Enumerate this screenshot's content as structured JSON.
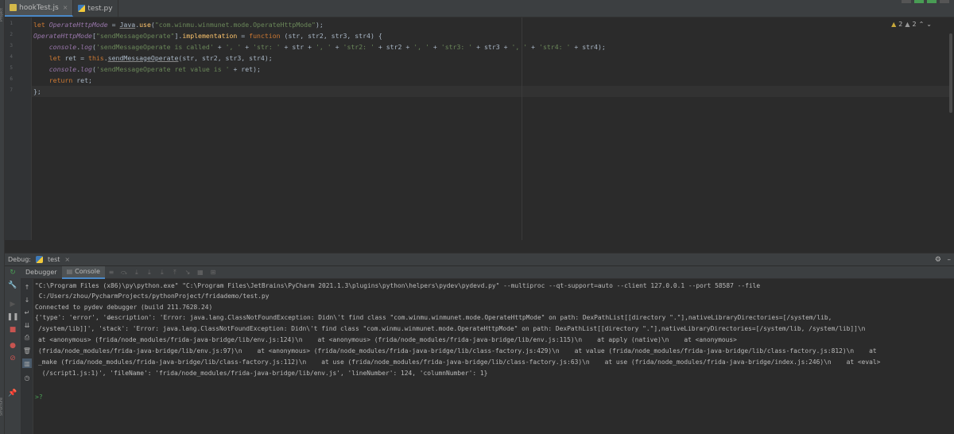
{
  "tabs": [
    {
      "label": "hookTest.js",
      "active": true,
      "icon": "js-file-icon"
    },
    {
      "label": "test.py",
      "active": false,
      "icon": "python-file-icon"
    }
  ],
  "editor": {
    "line_numbers": [
      "1",
      "2",
      "3",
      "4",
      "5",
      "6",
      "7"
    ],
    "warnings": {
      "warn_count": "2",
      "weak_count": "2"
    },
    "code": {
      "l1": {
        "kw": "let ",
        "var": "OperateHttpMode",
        "eq": " = ",
        "cls": "Java",
        "dot": ".",
        "fn": "use",
        "open": "(",
        "str": "\"com.winmu.winmunet.mode.OperateHttpMode\"",
        "close": ");"
      },
      "l2": {
        "var": "OperateHttpMode",
        "open": "[",
        "str": "\"sendMessageOperate\"",
        "mid": "].",
        "impl": "implementation",
        "eq": " = ",
        "kw": "function",
        "args": " (str, str2, str3, str4) {"
      },
      "l3": {
        "indent": "    ",
        "obj": "console",
        "dot": ".",
        "fn": "log",
        "open": "(",
        "s1": "'sendMessageOperate is called'",
        "p1": " + ",
        "s2": "', '",
        "p2": " + ",
        "s3": "'str: '",
        "p3": " + str + ",
        "s4": "', '",
        "p4": " + ",
        "s5": "'str2: '",
        "p5": " + str2 + ",
        "s6": "', '",
        "p6": " + ",
        "s7": "'str3: '",
        "p7": " + str3 + ",
        "s8": "', '",
        "p8": " + ",
        "s9": "'str4: '",
        "p9": " + str4);"
      },
      "l4": {
        "indent": "    ",
        "kw": "let ",
        "rest1": "ret = ",
        "kw2": "this",
        "dot": ".",
        "meth": "sendMessageOperate",
        "rest2": "(str, str2, str3, str4);"
      },
      "l5": {
        "indent": "    ",
        "obj": "console",
        "dot": ".",
        "fn": "log",
        "open": "(",
        "str": "'sendMessageOperate ret value is '",
        "rest": " + ret);"
      },
      "l6": {
        "indent": "    ",
        "kw": "return ",
        "rest": "ret;"
      },
      "l7": {
        "text": "};"
      }
    }
  },
  "debug": {
    "label": "Debug:",
    "config": "test",
    "tabs": {
      "debugger": "Debugger",
      "console": "Console"
    }
  },
  "console": {
    "lines": [
      "\"C:\\Program Files (x86)\\py\\python.exe\" \"C:\\Program Files\\JetBrains\\PyCharm 2021.1.3\\plugins\\python\\helpers\\pydev\\pydevd.py\" --multiproc --qt-support=auto --client 127.0.0.1 --port 58587 --file",
      " C:/Users/zhou/PycharmProjects/pythonProject/fridademo/test.py",
      "Connected to pydev debugger (build 211.7628.24)",
      "{'type': 'error', 'description': 'Error: java.lang.ClassNotFoundException: Didn\\'t find class \"com.winmu.winmunet.mode.OperateHttpMode\" on path: DexPathList[[directory \".\"],nativeLibraryDirectories=[/system/lib,",
      "/system/lib]]', 'stack': 'Error: java.lang.ClassNotFoundException: Didn\\'t find class \"com.winmu.winmunet.mode.OperateHttpMode\" on path: DexPathList[[directory \".\"],nativeLibraryDirectories=[/system/lib, /system/lib]]\\n",
      "at <anonymous> (frida/node_modules/frida-java-bridge/lib/env.js:124)\\n    at <anonymous> (frida/node_modules/frida-java-bridge/lib/env.js:115)\\n    at apply (native)\\n    at <anonymous>",
      "(frida/node_modules/frida-java-bridge/lib/env.js:97)\\n    at <anonymous> (frida/node_modules/frida-java-bridge/lib/class-factory.js:429)\\n    at value (frida/node_modules/frida-java-bridge/lib/class-factory.js:812)\\n    at",
      "_make (frida/node_modules/frida-java-bridge/lib/class-factory.js:112)\\n    at use (frida/node_modules/frida-java-bridge/lib/class-factory.js:63)\\n    at use (frida/node_modules/frida-java-bridge/index.js:246)\\n    at <eval>",
      " (/script1.js:1)', 'fileName': 'frida/node_modules/frida-java-bridge/lib/env.js', 'lineNumber': 124, 'columnNumber': 1}"
    ],
    "prompt": ">?"
  },
  "colors": {
    "accent": "#4a88c7",
    "keyword": "#cc7832",
    "string": "#6a8759",
    "function": "#ffc66d",
    "error": "#c75450",
    "run": "#499c54"
  }
}
